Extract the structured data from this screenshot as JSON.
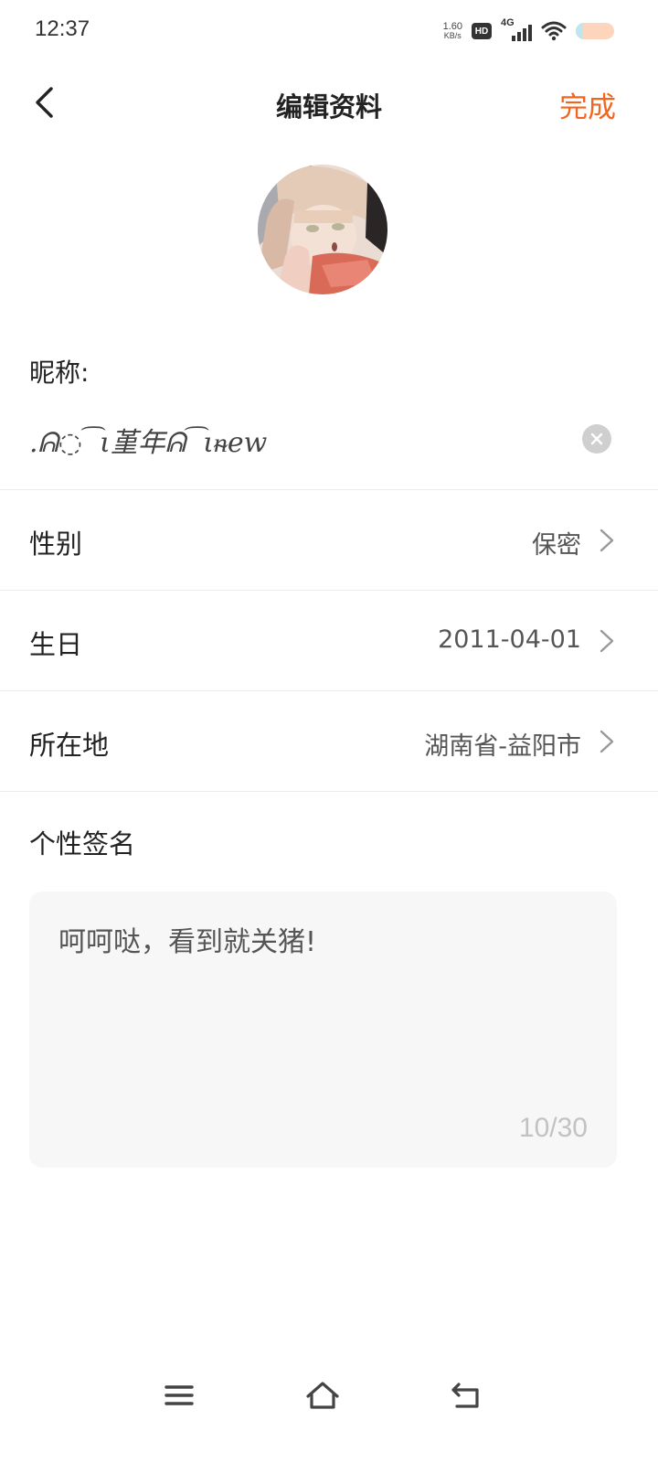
{
  "status_bar": {
    "time": "12:37",
    "net_speed_value": "1.60",
    "net_speed_unit": "KB/s",
    "hd_label": "HD",
    "network_type": "4G"
  },
  "header": {
    "title": "编辑资料",
    "done_label": "完成"
  },
  "profile": {
    "nickname_label": "昵称:",
    "nickname_value": ".ᕱ◌ ͡ ι堇年ᕱ ͡ ιᵰew"
  },
  "rows": [
    {
      "label": "性别",
      "value": "保密"
    },
    {
      "label": "生日",
      "value": "2011-04-01"
    },
    {
      "label": "所在地",
      "value": "湖南省-益阳市"
    }
  ],
  "signature": {
    "label": "个性签名",
    "text": "呵呵哒，看到就关猪!",
    "counter": "10/30"
  },
  "colors": {
    "accent": "#f2651f",
    "divider": "#ececec",
    "signature_bg": "#f7f7f7"
  },
  "icons": {
    "back": "chevron-left-icon",
    "clear": "clear-circle-icon",
    "row_arrow": "chevron-right-icon",
    "nav_menu": "menu-icon",
    "nav_home": "home-icon",
    "nav_back": "back-icon"
  }
}
